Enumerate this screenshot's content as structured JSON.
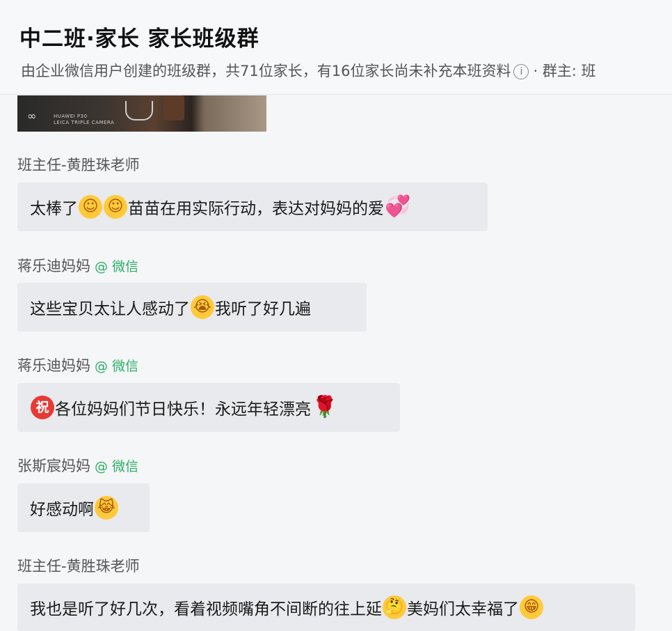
{
  "header": {
    "title": "中二班·家长 家长班级群",
    "subtitle_main": "由企业微信用户创建的班级群，共71位家长，有16位家长尚未补充本班资料",
    "info_icon": "i",
    "subtitle_tail": "· 群主: 班"
  },
  "photo": {
    "lens_glyph": "∞",
    "caption_line1": "HUAWEI P30",
    "caption_line2": "LEICA TRIPLE CAMERA"
  },
  "messages": [
    {
      "sender": "班主任-黄胜珠老师",
      "parts": [
        {
          "t": "太棒了"
        },
        {
          "emoji": "☺",
          "kind": "yellow"
        },
        {
          "emoji": "☺",
          "kind": "yellow"
        },
        {
          "t": "苗苗在用实际行动，表达对妈妈的爱"
        },
        {
          "emoji": "💞",
          "kind": "heart"
        }
      ]
    },
    {
      "sender": "蒋乐迪妈妈",
      "source": "@ 微信",
      "parts": [
        {
          "t": "这些宝贝太让人感动了"
        },
        {
          "emoji": "😭",
          "kind": "yellow"
        },
        {
          "t": "我听了好几遍"
        }
      ]
    },
    {
      "sender": "蒋乐迪妈妈",
      "source": "@ 微信",
      "parts": [
        {
          "emoji": "祝",
          "kind": "zhu"
        },
        {
          "t": "各位妈妈们节日快乐！永远年轻漂亮"
        },
        {
          "emoji": "🌹",
          "kind": "rose"
        }
      ]
    },
    {
      "sender": "张斯宸妈妈",
      "source": "@ 微信",
      "parts": [
        {
          "t": "好感动啊"
        },
        {
          "emoji": "😹",
          "kind": "yellow"
        }
      ]
    },
    {
      "sender": "班主任-黄胜珠老师",
      "parts": [
        {
          "t": "我也是听了好几次，看着视频嘴角不间断的往上延"
        },
        {
          "emoji": "🤔",
          "kind": "yellow"
        },
        {
          "t": "美妈们太幸福了"
        },
        {
          "emoji": "😁",
          "kind": "yellow"
        }
      ]
    }
  ]
}
